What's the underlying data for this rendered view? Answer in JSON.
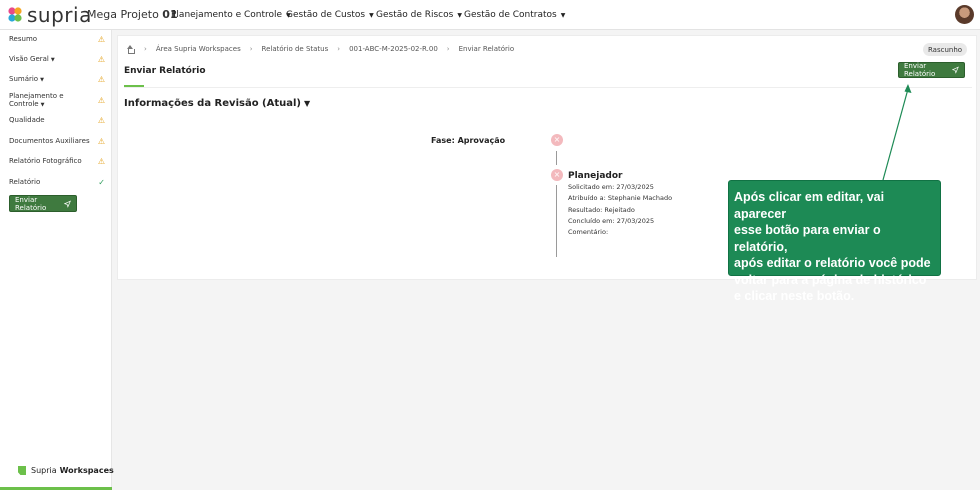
{
  "topbar": {
    "logo_text": "supria",
    "project_name": "Mega Projeto",
    "project_number": "01",
    "nav": [
      {
        "label": "Planejamento e Controle"
      },
      {
        "label": "Gestão de Custos"
      },
      {
        "label": "Gestão de Riscos"
      },
      {
        "label": "Gestão de Contratos"
      }
    ]
  },
  "sidebar": {
    "items": [
      {
        "label": "Resumo",
        "status": "warning"
      },
      {
        "label": "Visão Geral",
        "status": "warning"
      },
      {
        "label": "Sumário",
        "status": "warning"
      },
      {
        "label": "Planejamento e Controle",
        "status": "warning"
      },
      {
        "label": "Qualidade",
        "status": "warning"
      },
      {
        "label": "Documentos Auxiliares",
        "status": "warning"
      },
      {
        "label": "Relatório Fotográfico",
        "status": "warning"
      },
      {
        "label": "Relatório",
        "status": "complete"
      }
    ],
    "send_button": "Enviar Relatório",
    "brand_prefix": "Supria",
    "brand_suffix": "Workspaces"
  },
  "breadcrumb": [
    "Área Supria Workspaces",
    "Relatório de Status",
    "001-ABC-M-2025-02-R.00",
    "Enviar Relatório"
  ],
  "status_pill": "Rascunho",
  "page_title": "Enviar Relatório",
  "send_button": "Enviar Relatório",
  "section_title": "Informações da Revisão (Atual)",
  "timeline": {
    "phase_label": "Fase: Aprovação",
    "step": {
      "title": "Planejador",
      "requested": "Solicitado em: 27/03/2025",
      "assigned": "Atribuído a: Stephanie Machado",
      "result": "Resultado: Rejeitado",
      "completed": "Concluído em: 27/03/2025",
      "comment": "Comentário:"
    }
  },
  "callout": {
    "lines": [
      "Após clicar em editar, vai aparecer",
      "esse botão para enviar o relatório,",
      "após editar o relatório você pode",
      "voltar para a página de histórico",
      "e clicar neste botão."
    ]
  },
  "colors": {
    "brand_green": "#6cc04a",
    "button_green": "#3f7a3f",
    "callout_green": "#1d8a55",
    "warning": "#e4a21c",
    "rejected_dot": "#f3b9bd"
  }
}
